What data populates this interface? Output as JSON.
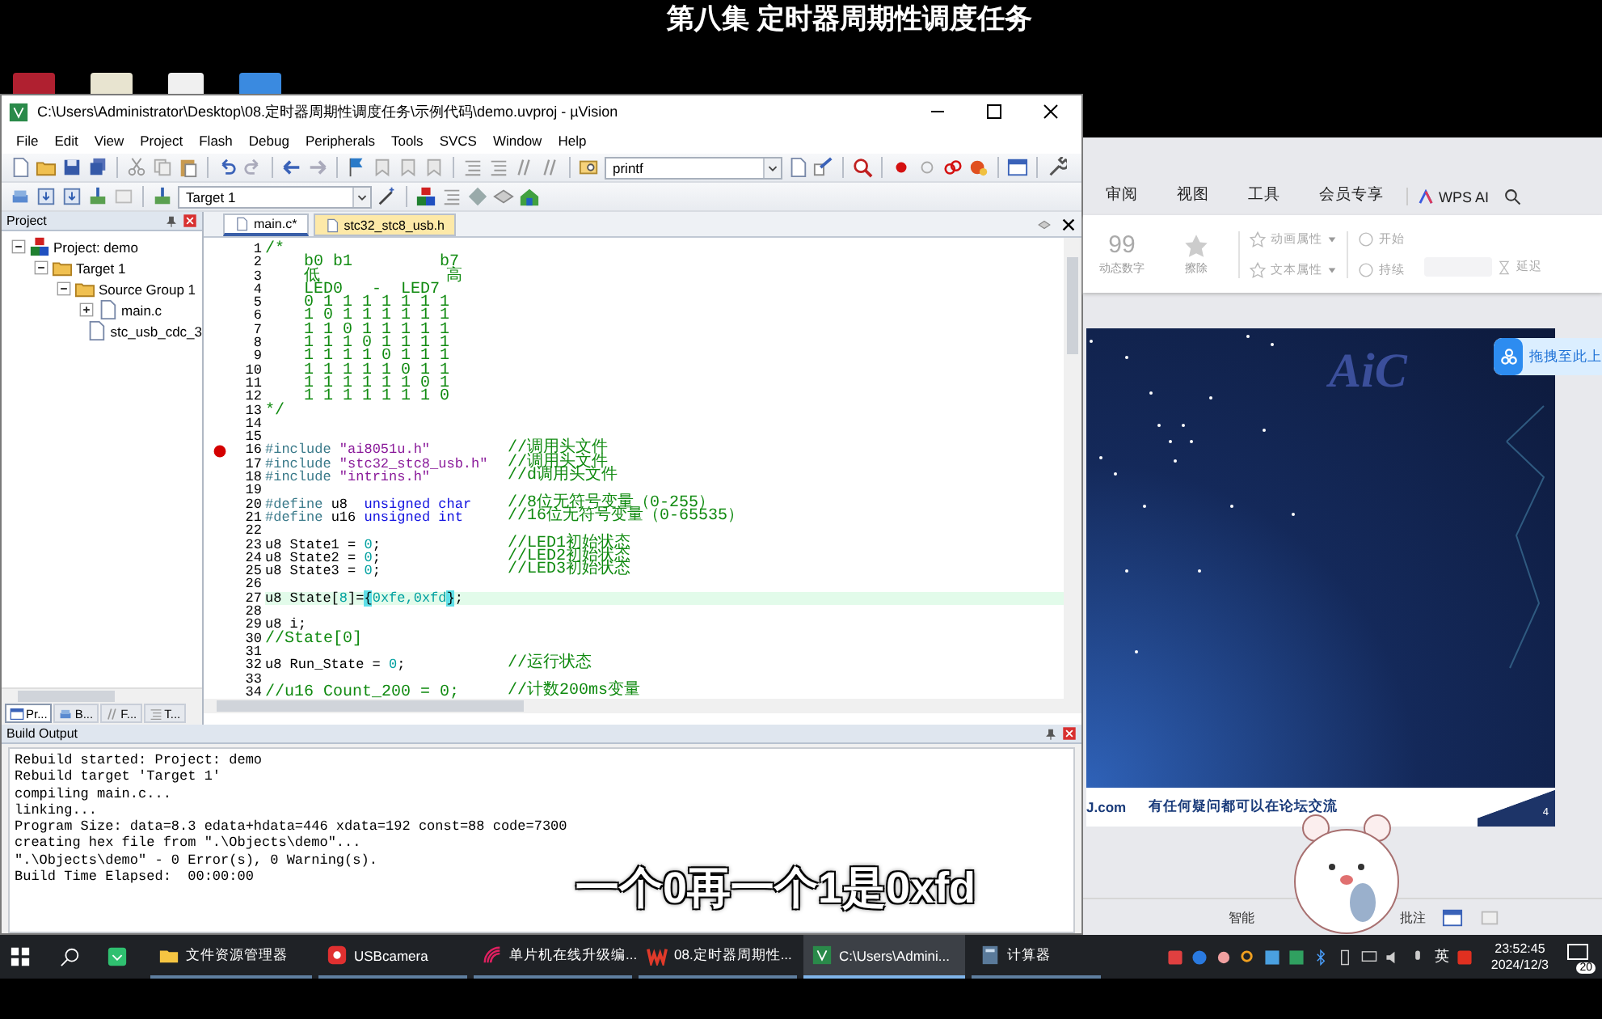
{
  "video_title": "第八集 定时器周期性调度任务",
  "subtitle": "一个0再一个1是0xfd",
  "uvision": {
    "title": "C:\\Users\\Administrator\\Desktop\\08.定时器周期性调度任务\\示例代码\\demo.uvproj - µVision",
    "menu": [
      "File",
      "Edit",
      "View",
      "Project",
      "Flash",
      "Debug",
      "Peripherals",
      "Tools",
      "SVCS",
      "Window",
      "Help"
    ],
    "find_box": {
      "value": "printf"
    },
    "target_select": {
      "value": "Target 1"
    },
    "project_panel": {
      "title": "Project",
      "tree": [
        {
          "label": "Project: demo",
          "kind": "project",
          "expanded": true,
          "children": [
            {
              "label": "Target 1",
              "kind": "target",
              "expanded": true,
              "children": [
                {
                  "label": "Source Group 1",
                  "kind": "group",
                  "expanded": true,
                  "children": [
                    {
                      "label": "main.c",
                      "kind": "file",
                      "expanded": false
                    },
                    {
                      "label": "stc_usb_cdc_3",
                      "kind": "file"
                    }
                  ]
                }
              ]
            }
          ]
        }
      ],
      "tabs": [
        {
          "label": "Pr...",
          "kind": "project",
          "selected": true
        },
        {
          "label": "B...",
          "kind": "books",
          "selected": false
        },
        {
          "label": "F...",
          "kind": "functions",
          "selected": false
        },
        {
          "label": "T...",
          "kind": "templates",
          "selected": false
        }
      ]
    },
    "editor_tabs": [
      {
        "label": "main.c*",
        "selected": true
      },
      {
        "label": "stc32_stc8_usb.h",
        "selected": false
      }
    ],
    "code_lines": [
      {
        "number": "1",
        "breakpoint": false,
        "current": false,
        "segments": [
          {
            "kind": "comment",
            "text": "/*"
          }
        ]
      },
      {
        "number": "2",
        "breakpoint": false,
        "current": false,
        "segments": [
          {
            "kind": "comment",
            "text": "    b0 b1         b7"
          }
        ]
      },
      {
        "number": "3",
        "breakpoint": false,
        "current": false,
        "segments": [
          {
            "kind": "comment",
            "text": "    低             高"
          }
        ]
      },
      {
        "number": "4",
        "breakpoint": false,
        "current": false,
        "segments": [
          {
            "kind": "comment",
            "text": "    LED0   -  LED7"
          }
        ]
      },
      {
        "number": "5",
        "breakpoint": false,
        "current": false,
        "segments": [
          {
            "kind": "comment",
            "text": "    0 1 1 1 1 1 1 1"
          }
        ]
      },
      {
        "number": "6",
        "breakpoint": false,
        "current": false,
        "segments": [
          {
            "kind": "comment",
            "text": "    1 0 1 1 1 1 1 1"
          }
        ]
      },
      {
        "number": "7",
        "breakpoint": false,
        "current": false,
        "segments": [
          {
            "kind": "comment",
            "text": "    1 1 0 1 1 1 1 1"
          }
        ]
      },
      {
        "number": "8",
        "breakpoint": false,
        "current": false,
        "segments": [
          {
            "kind": "comment",
            "text": "    1 1 1 0 1 1 1 1"
          }
        ]
      },
      {
        "number": "9",
        "breakpoint": false,
        "current": false,
        "segments": [
          {
            "kind": "comment",
            "text": "    1 1 1 1 0 1 1 1"
          }
        ]
      },
      {
        "number": "10",
        "breakpoint": false,
        "current": false,
        "segments": [
          {
            "kind": "comment",
            "text": "    1 1 1 1 1 0 1 1"
          }
        ]
      },
      {
        "number": "11",
        "breakpoint": false,
        "current": false,
        "segments": [
          {
            "kind": "comment",
            "text": "    1 1 1 1 1 1 0 1"
          }
        ]
      },
      {
        "number": "12",
        "breakpoint": false,
        "current": false,
        "segments": [
          {
            "kind": "comment",
            "text": "    1 1 1 1 1 1 1 0"
          }
        ]
      },
      {
        "number": "13",
        "breakpoint": false,
        "current": false,
        "segments": [
          {
            "kind": "comment",
            "text": "*/"
          }
        ]
      },
      {
        "number": "14",
        "breakpoint": false,
        "current": false
      },
      {
        "number": "15",
        "breakpoint": false,
        "current": false
      },
      {
        "number": "16",
        "breakpoint": true,
        "current": false,
        "segments": [
          {
            "kind": "directive",
            "text": "#include"
          },
          {
            "kind": "string",
            "text": " \"ai8051u.h\""
          }
        ],
        "note": "//调用头文件"
      },
      {
        "number": "17",
        "breakpoint": false,
        "current": false,
        "segments": [
          {
            "kind": "directive",
            "text": "#include"
          },
          {
            "kind": "string",
            "text": " \"stc32_stc8_usb.h\""
          }
        ],
        "note": "//调用头文件"
      },
      {
        "number": "18",
        "breakpoint": false,
        "current": false,
        "segments": [
          {
            "kind": "directive",
            "text": "#include"
          },
          {
            "kind": "string",
            "text": " \"intrins.h\""
          }
        ],
        "note": "//d调用头文件"
      },
      {
        "number": "19",
        "breakpoint": false,
        "current": false
      },
      {
        "number": "20",
        "breakpoint": false,
        "current": false,
        "segments": [
          {
            "kind": "directive",
            "text": "#define"
          },
          {
            "kind": "plain",
            "text": " u8  "
          },
          {
            "kind": "keyword",
            "text": "unsigned char"
          }
        ],
        "note": "//8位无符号变量（0-255）"
      },
      {
        "number": "21",
        "breakpoint": false,
        "current": false,
        "segments": [
          {
            "kind": "directive",
            "text": "#define"
          },
          {
            "kind": "plain",
            "text": " u16 "
          },
          {
            "kind": "keyword",
            "text": "unsigned int"
          }
        ],
        "note": "//16位无符号变量（0-65535）"
      },
      {
        "number": "22",
        "breakpoint": false,
        "current": false
      },
      {
        "number": "23",
        "breakpoint": false,
        "current": false,
        "segments": [
          {
            "kind": "plain",
            "text": "u8 State1 = "
          },
          {
            "kind": "number",
            "text": "0"
          },
          {
            "kind": "plain",
            "text": ";"
          }
        ],
        "note": "//LED1初始状态"
      },
      {
        "number": "24",
        "breakpoint": false,
        "current": false,
        "segments": [
          {
            "kind": "plain",
            "text": "u8 State2 = "
          },
          {
            "kind": "number",
            "text": "0"
          },
          {
            "kind": "plain",
            "text": ";"
          }
        ],
        "note": "//LED2初始状态"
      },
      {
        "number": "25",
        "breakpoint": false,
        "current": false,
        "segments": [
          {
            "kind": "plain",
            "text": "u8 State3 = "
          },
          {
            "kind": "number",
            "text": "0"
          },
          {
            "kind": "plain",
            "text": ";"
          }
        ],
        "note": "//LED3初始状态"
      },
      {
        "number": "26",
        "breakpoint": false,
        "current": false
      },
      {
        "number": "27",
        "breakpoint": false,
        "current": true,
        "segments": [
          {
            "kind": "plain",
            "text": "u8 State["
          },
          {
            "kind": "number",
            "text": "8"
          },
          {
            "kind": "plain",
            "text": "]="
          },
          {
            "kind": "brace",
            "text": "{"
          },
          {
            "kind": "number",
            "text": "0xfe,0xfd"
          },
          {
            "kind": "brace",
            "text": "}"
          },
          {
            "kind": "plain",
            "text": ";"
          }
        ]
      },
      {
        "number": "28",
        "breakpoint": false,
        "current": false
      },
      {
        "number": "29",
        "breakpoint": false,
        "current": false,
        "segments": [
          {
            "kind": "plain",
            "text": "u8 i;"
          }
        ]
      },
      {
        "number": "30",
        "breakpoint": false,
        "current": false,
        "segments": [
          {
            "kind": "comment",
            "text": "//State[0]"
          }
        ]
      },
      {
        "number": "31",
        "breakpoint": false,
        "current": false
      },
      {
        "number": "32",
        "breakpoint": false,
        "current": false,
        "segments": [
          {
            "kind": "plain",
            "text": "u8 Run_State = "
          },
          {
            "kind": "number",
            "text": "0"
          },
          {
            "kind": "plain",
            "text": ";"
          }
        ],
        "note": "//运行状态"
      },
      {
        "number": "33",
        "breakpoint": false,
        "current": false
      },
      {
        "number": "34",
        "breakpoint": false,
        "current": false,
        "segments": [
          {
            "kind": "comment",
            "text": "//u16 Count_200 = 0;"
          }
        ],
        "note": "//计数200ms变量"
      }
    ],
    "build_output": {
      "title": "Build Output",
      "lines": [
        "Rebuild started: Project: demo",
        "Rebuild target 'Target 1'",
        "compiling main.c...",
        "linking...",
        "Program Size: data=8.3 edata+hdata=446 xdata=192 const=88 code=7300",
        "creating hex file from \".\\Objects\\demo\"...",
        "\".\\Objects\\demo\" - 0 Error(s), 0 Warning(s).",
        "Build Time Elapsed:  00:00:00"
      ]
    }
  },
  "wps": {
    "menu_tabs": [
      "审阅",
      "视图",
      "工具",
      "会员专享"
    ],
    "ai_label": "WPS AI",
    "ribbon": {
      "number_glyph": "99",
      "big_buttons": [
        "动态数字",
        "擦除"
      ],
      "menus": [
        "动画属性",
        "文本属性"
      ],
      "timing": [
        "开始",
        "持续",
        "延迟"
      ]
    },
    "drag_hint": "拖拽至此上",
    "slide": {
      "logo": "AiC",
      "footer_site": "J.com",
      "footer_text": "有任何疑问都可以在论坛交流",
      "page": "4"
    },
    "status": [
      "智能",
      "批注"
    ]
  },
  "taskbar": {
    "apps": [
      {
        "label": "文件资源管理器",
        "kind": "folder",
        "selected": false
      },
      {
        "label": "USBcamera",
        "kind": "camera",
        "selected": false
      },
      {
        "label": "单片机在线升级编...",
        "kind": "signal",
        "selected": false
      },
      {
        "label": "08.定时器周期性...",
        "kind": "wps",
        "selected": false
      },
      {
        "label": "C:\\Users\\Admini...",
        "kind": "keil",
        "selected": true
      },
      {
        "label": "计算器",
        "kind": "calculator",
        "selected": false
      }
    ],
    "ime": "英",
    "time": "23:52:45",
    "date": "2024/12/3",
    "notifications": "20"
  }
}
